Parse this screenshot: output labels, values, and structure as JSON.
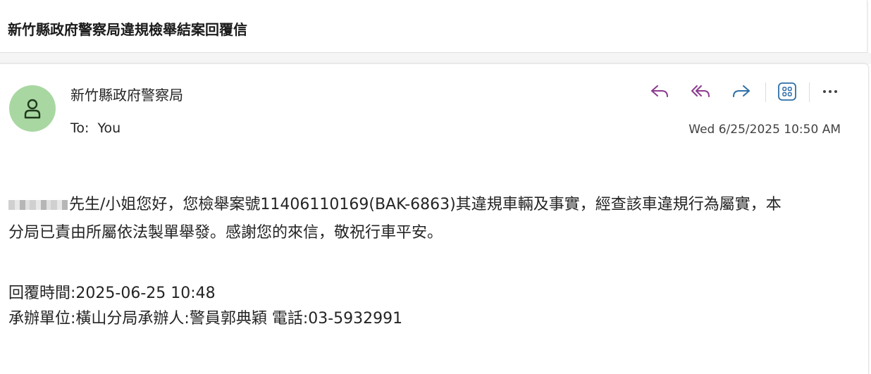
{
  "subject": "新竹縣政府警察局違規檢舉結案回覆信",
  "sender": {
    "name": "新竹縣政府警察局",
    "avatar_icon": "person-icon",
    "avatar_color": "#a9d7a2"
  },
  "recipient": {
    "label": "To:",
    "value": "You"
  },
  "date": "Wed 6/25/2025 10:50 AM",
  "toolbar": {
    "reply_icon": "reply-icon",
    "reply_all_icon": "reply-all-icon",
    "forward_icon": "forward-icon",
    "apps_icon": "apps-icon",
    "more_icon": "more-icon",
    "reply_color": "#8b3a8f",
    "forward_color": "#2f6fa7"
  },
  "body": {
    "greeting_line1": "先生/小姐您好，您檢舉案號11406110169(BAK-6863)其違規車輛及事實，經查該車違規行為屬實，本",
    "greeting_line2": "分局已責由所屬依法製單舉發。感謝您的來信，敬祝行車平安。",
    "reply_time": "回覆時間:2025-06-25 10:48",
    "handler": "承辦單位:橫山分局承辦人:警員郭典穎 電話:03-5932991"
  }
}
